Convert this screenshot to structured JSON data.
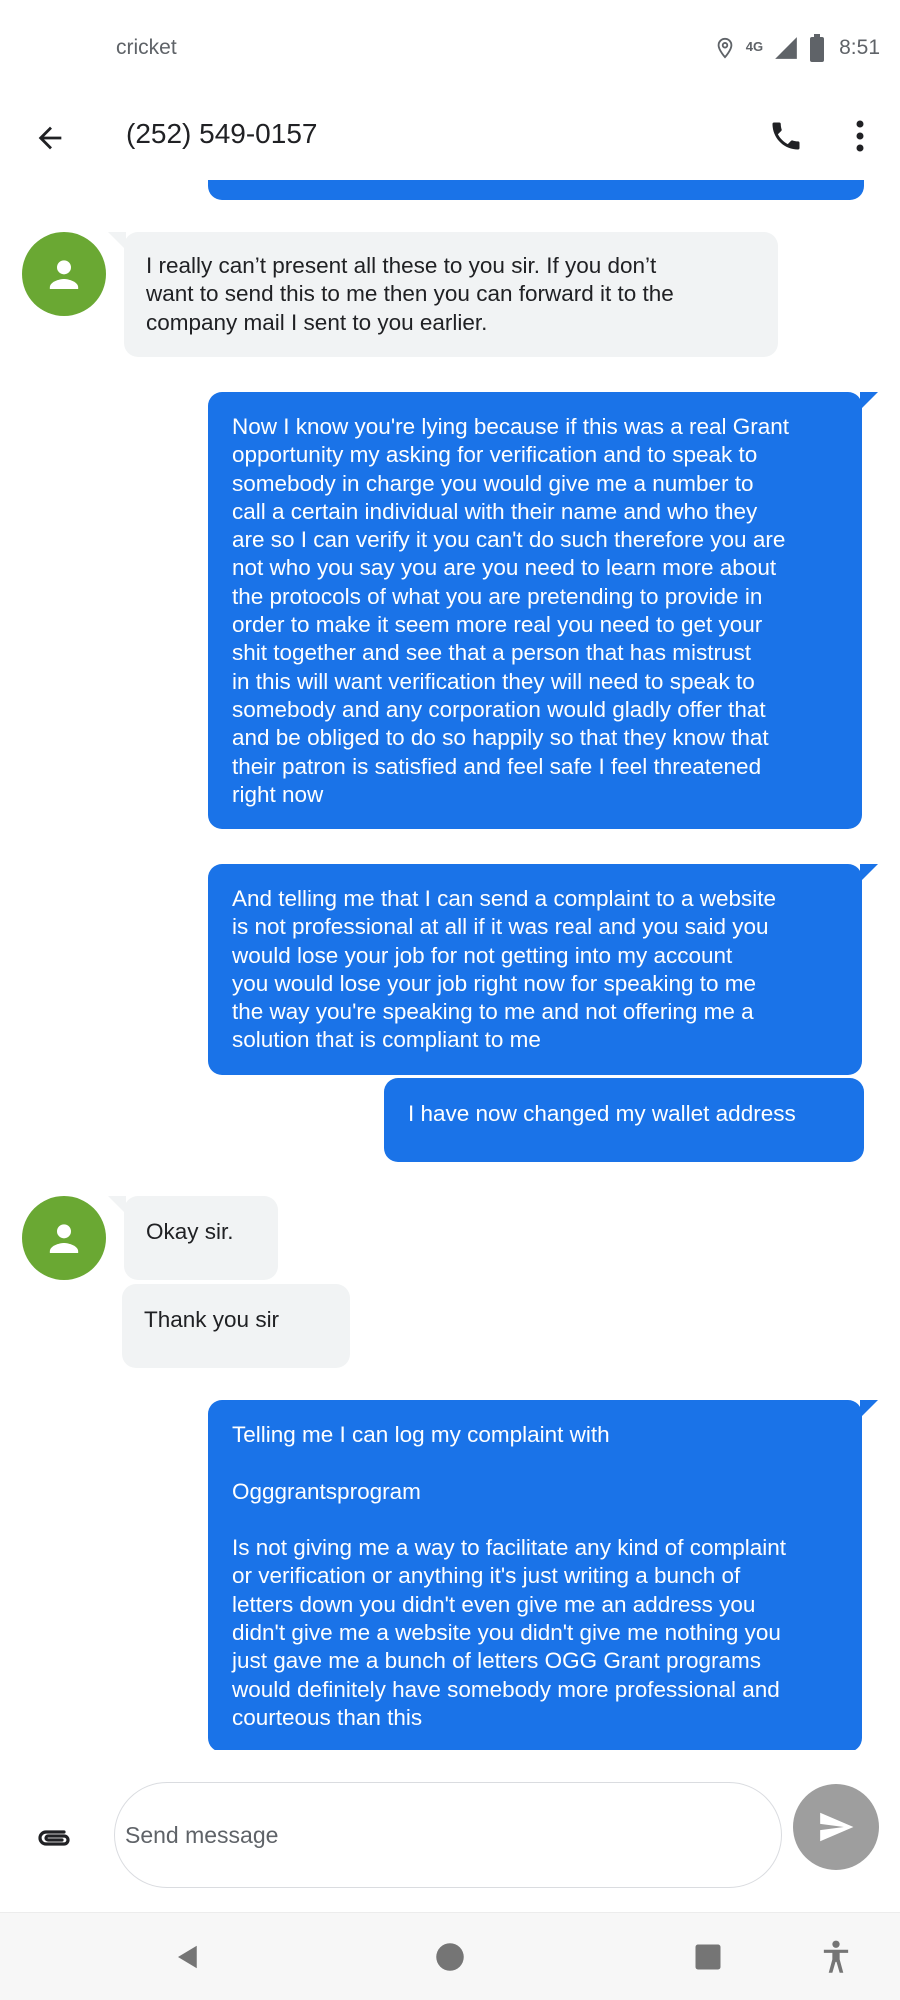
{
  "status_bar": {
    "carrier": "cricket",
    "network": "4G",
    "time": "8:51",
    "icons": [
      "location-icon",
      "network-4g-lte-icon",
      "signal-icon",
      "battery-icon"
    ]
  },
  "app_bar": {
    "contact": "(252) 549-0157",
    "icons": [
      "back-arrow-icon",
      "phone-icon",
      "more-vert-icon"
    ]
  },
  "messages": [
    {
      "direction": "received",
      "text": "I really can’t present all these to you sir. If you don’t\nwant to send this to me then you can forward it to the\ncompany mail I sent to you earlier."
    },
    {
      "direction": "sent",
      "text": "Now I know you're lying because if this was a real Grant\nopportunity my asking for verification and to speak to\nsomebody in charge you would give me a number to\ncall a certain individual with their name and who they\nare so I can verify it you can't do such therefore you are\nnot who you say you are you need to learn more about\nthe protocols of what you are pretending to provide in\norder to make it seem more real you need to get your\nshit together and see that a person that has mistrust\nin this will want verification they will need to speak to\nsomebody and any corporation would gladly offer that\nand be obliged to do so happily so that they know that\ntheir patron is satisfied and feel safe I feel threatened\nright now"
    },
    {
      "direction": "sent",
      "text": "And telling me that I can send a complaint to a website\nis not professional at all if it was real and you said you\nwould lose your job for not getting into my account\nyou would lose your job right now for speaking to me\nthe way you're speaking to me and not offering me a\nsolution that is compliant to me"
    },
    {
      "direction": "sent",
      "text": "I have now changed my wallet address"
    },
    {
      "direction": "received",
      "text": "Okay sir."
    },
    {
      "direction": "received",
      "text": "Thank you sir"
    },
    {
      "direction": "sent",
      "text": "Telling me I can log my complaint with\n\nOgggrantsprogram\n\nIs not giving me a way to facilitate any kind of complaint\nor verification or anything it's just writing a bunch of\nletters down you didn't even give me an address you\ndidn't give me a website you didn't give me nothing you\njust gave me a bunch of letters OGG Grant programs\nwould definitely have somebody more professional and\ncourteous than this"
    }
  ],
  "compose": {
    "placeholder": "Send message",
    "icons": [
      "attach-icon",
      "send-icon"
    ]
  },
  "nav_bar": {
    "icons": [
      "back-triangle-icon",
      "home-circle-icon",
      "recents-square-icon",
      "accessibility-icon"
    ]
  },
  "colors": {
    "sent_bubble": "#1a73e8",
    "received_bubble": "#f1f3f4",
    "avatar": "#6aa833",
    "send_button": "#9e9e9e"
  }
}
